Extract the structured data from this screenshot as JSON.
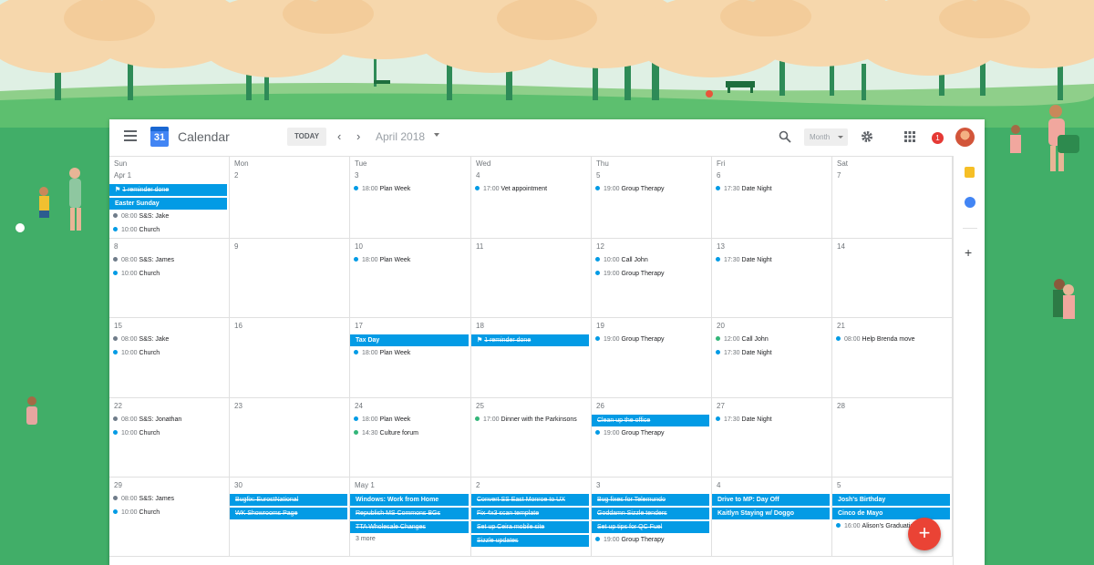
{
  "header": {
    "app_title": "Calendar",
    "logo_day": "31",
    "today_label": "TODAY",
    "month_label": "April 2018",
    "view_label": "Month",
    "notifications_count": "1",
    "icons": [
      "menu-icon",
      "chevron-left-icon",
      "chevron-right-icon",
      "search-icon",
      "gear-icon",
      "apps-grid-icon"
    ]
  },
  "weekdays": [
    "Sun",
    "Mon",
    "Tue",
    "Wed",
    "Thu",
    "Fri",
    "Sat"
  ],
  "weeks": [
    {
      "days": [
        {
          "num": "Apr 1",
          "bars": [
            {
              "title": "1 reminder done",
              "done": true,
              "icon": true
            },
            {
              "title": "Easter Sunday"
            }
          ],
          "events": [
            {
              "time": "08:00",
              "title": "S&S: Jake",
              "dot": "grey"
            },
            {
              "time": "10:00",
              "title": "Church"
            }
          ]
        },
        {
          "num": "2"
        },
        {
          "num": "3",
          "events": [
            {
              "time": "18:00",
              "title": "Plan Week"
            }
          ]
        },
        {
          "num": "4",
          "events": [
            {
              "time": "17:00",
              "title": "Vet appointment"
            }
          ]
        },
        {
          "num": "5",
          "events": [
            {
              "time": "19:00",
              "title": "Group Therapy"
            }
          ]
        },
        {
          "num": "6",
          "events": [
            {
              "time": "17:30",
              "title": "Date Night"
            }
          ]
        },
        {
          "num": "7"
        }
      ]
    },
    {
      "days": [
        {
          "num": "8",
          "events": [
            {
              "time": "08:00",
              "title": "S&S: James",
              "dot": "grey"
            },
            {
              "time": "10:00",
              "title": "Church"
            }
          ]
        },
        {
          "num": "9"
        },
        {
          "num": "10",
          "events": [
            {
              "time": "18:00",
              "title": "Plan Week"
            }
          ]
        },
        {
          "num": "11"
        },
        {
          "num": "12",
          "events": [
            {
              "time": "10:00",
              "title": "Call John"
            },
            {
              "time": "19:00",
              "title": "Group Therapy"
            }
          ]
        },
        {
          "num": "13",
          "events": [
            {
              "time": "17:30",
              "title": "Date Night"
            }
          ]
        },
        {
          "num": "14"
        }
      ]
    },
    {
      "days": [
        {
          "num": "15",
          "events": [
            {
              "time": "08:00",
              "title": "S&S: Jake",
              "dot": "grey"
            },
            {
              "time": "10:00",
              "title": "Church"
            }
          ]
        },
        {
          "num": "16"
        },
        {
          "num": "17",
          "bars": [
            {
              "title": "Tax Day"
            }
          ],
          "events": [
            {
              "time": "18:00",
              "title": "Plan Week"
            }
          ]
        },
        {
          "num": "18",
          "bars": [
            {
              "title": "1 reminder done",
              "done": true,
              "icon": true
            }
          ]
        },
        {
          "num": "19",
          "events": [
            {
              "time": "19:00",
              "title": "Group Therapy"
            }
          ]
        },
        {
          "num": "20",
          "events": [
            {
              "time": "12:00",
              "title": "Call John",
              "dot": "green"
            },
            {
              "time": "17:30",
              "title": "Date Night"
            }
          ]
        },
        {
          "num": "21",
          "events": [
            {
              "time": "08:00",
              "title": "Help Brenda move"
            }
          ]
        }
      ]
    },
    {
      "days": [
        {
          "num": "22",
          "events": [
            {
              "time": "08:00",
              "title": "S&S: Jonathan",
              "dot": "grey"
            },
            {
              "time": "10:00",
              "title": "Church"
            }
          ]
        },
        {
          "num": "23"
        },
        {
          "num": "24",
          "events": [
            {
              "time": "18:00",
              "title": "Plan Week"
            },
            {
              "time": "14:30",
              "title": "Culture forum",
              "dot": "green"
            }
          ]
        },
        {
          "num": "25",
          "events": [
            {
              "time": "17:00",
              "title": "Dinner with the Parkinsons",
              "dot": "green"
            }
          ]
        },
        {
          "num": "26",
          "bars": [
            {
              "title": "Clean up the office",
              "done": true
            }
          ],
          "events": [
            {
              "time": "19:00",
              "title": "Group Therapy"
            }
          ]
        },
        {
          "num": "27",
          "events": [
            {
              "time": "17:30",
              "title": "Date Night"
            }
          ]
        },
        {
          "num": "28"
        }
      ]
    },
    {
      "days": [
        {
          "num": "29",
          "events": [
            {
              "time": "08:00",
              "title": "S&S: James",
              "dot": "grey"
            },
            {
              "time": "10:00",
              "title": "Church"
            }
          ]
        },
        {
          "num": "30",
          "bars": [
            {
              "title": "Bugfix: EurostNational",
              "done": true
            },
            {
              "title": "WK Showrooms Page",
              "done": true
            }
          ]
        },
        {
          "num": "May 1",
          "bars": [
            {
              "title": "Windows: Work from Home"
            },
            {
              "title": "Republish MS Commons BGs",
              "done": true
            },
            {
              "title": "TTA Wholesale Changes",
              "done": true
            }
          ],
          "more": "3 more"
        },
        {
          "num": "2",
          "bars": [
            {
              "title": "Convert SS East Monroe to UX",
              "done": true
            },
            {
              "title": "Fix 4x3 scan template",
              "done": true
            },
            {
              "title": "Set up Ceira mobile site",
              "done": true
            },
            {
              "title": "Sizzle updates",
              "done": true
            }
          ]
        },
        {
          "num": "3",
          "bars": [
            {
              "title": "Bug fixes for Telemundo",
              "done": true
            },
            {
              "title": "Goddamn Sizzle tenders",
              "done": true
            },
            {
              "title": "Set up tips for QC Fuel",
              "done": true
            }
          ],
          "events": [
            {
              "time": "19:00",
              "title": "Group Therapy"
            }
          ]
        },
        {
          "num": "4",
          "bars": [
            {
              "title": "Drive to MP: Day Off"
            },
            {
              "title": "Kaitlyn Staying w/ Doggo"
            }
          ]
        },
        {
          "num": "5",
          "bars": [
            {
              "title": "Josh's Birthday"
            },
            {
              "title": "Cinco de Mayo"
            }
          ],
          "events": [
            {
              "time": "16:00",
              "title": "Alison's Graduation"
            }
          ]
        }
      ]
    }
  ],
  "side_panel": {
    "add_label": "+"
  },
  "fab_label": "+"
}
